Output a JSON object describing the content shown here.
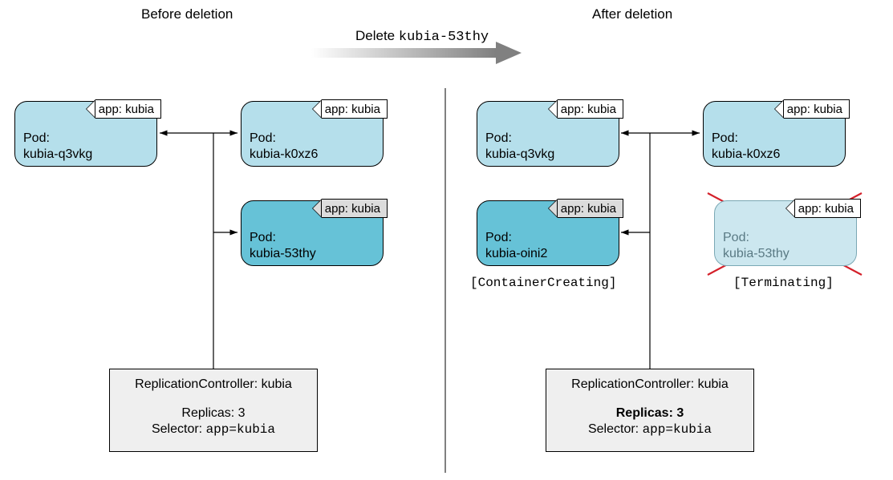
{
  "titles": {
    "before": "Before deletion",
    "after": "After deletion"
  },
  "action": {
    "prefix": "Delete ",
    "code": "kubia-53thy"
  },
  "label_app": "app: kubia",
  "pods": {
    "before_q3vkg": {
      "line1": "Pod:",
      "line2": "kubia-q3vkg"
    },
    "before_k0xz6": {
      "line1": "Pod:",
      "line2": "kubia-k0xz6"
    },
    "before_53thy": {
      "line1": "Pod:",
      "line2": "kubia-53thy"
    },
    "after_q3vkg": {
      "line1": "Pod:",
      "line2": "kubia-q3vkg"
    },
    "after_k0xz6": {
      "line1": "Pod:",
      "line2": "kubia-k0xz6"
    },
    "after_oini2": {
      "line1": "Pod:",
      "line2": "kubia-oini2"
    },
    "after_53thy": {
      "line1": "Pod:",
      "line2": "kubia-53thy"
    }
  },
  "statuses": {
    "creating": "[ContainerCreating]",
    "terminating": "[Terminating]"
  },
  "rc": {
    "title": "ReplicationController: kubia",
    "replicas_label": "Replicas: 3",
    "selector_prefix": "Selector: ",
    "selector_value": "app=kubia"
  }
}
